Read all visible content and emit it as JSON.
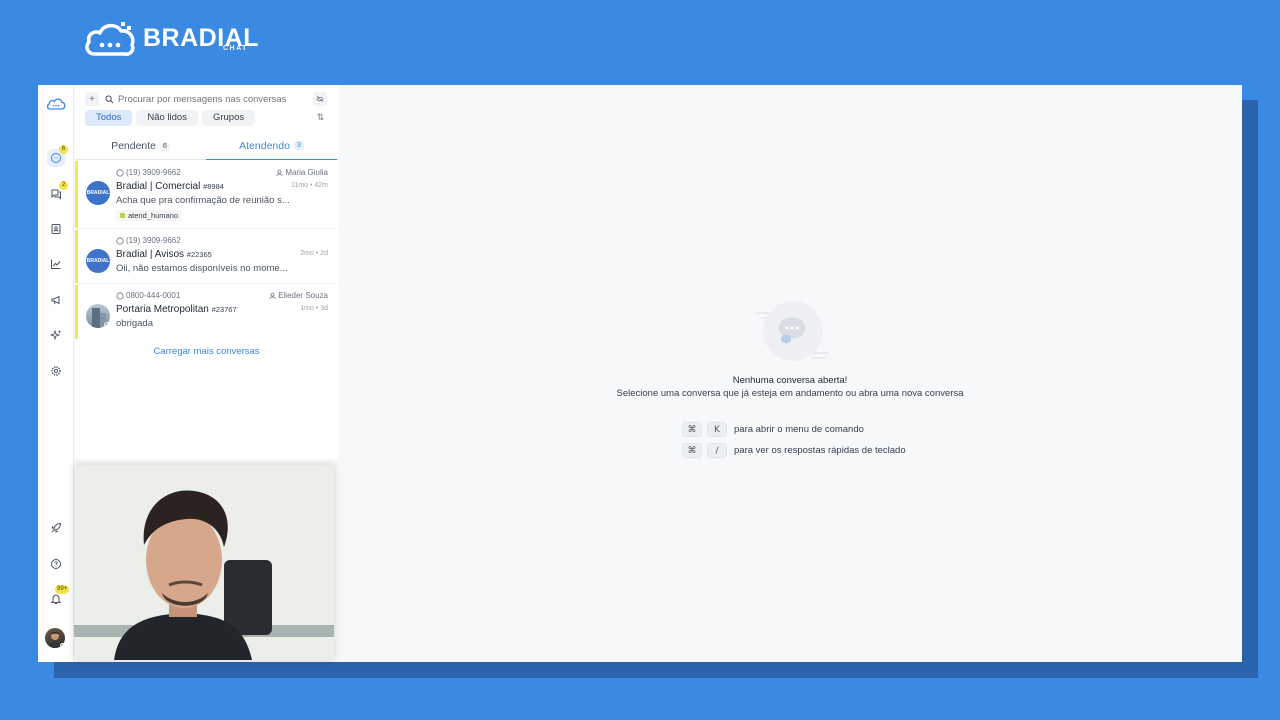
{
  "brand": {
    "name": "BRADIAL",
    "sub": "CHAT"
  },
  "rail": {
    "conversations_badge": "6",
    "mentions_badge": "2",
    "notifications_badge": "99+"
  },
  "search": {
    "placeholder": "Procurar por mensagens nas conversas"
  },
  "filters": [
    "Todos",
    "Não lidos",
    "Grupos"
  ],
  "tabs": [
    {
      "label": "Pendente",
      "count": "6"
    },
    {
      "label": "Atendendo",
      "count": "3"
    }
  ],
  "conversations": [
    {
      "phone": "(19) 3909-9662",
      "agent": "Maria Giulia",
      "title": "Bradial | Comercial",
      "number": "#8984",
      "time": "11mo • 42m",
      "preview": "Acha que pra confirmação de reunião s...",
      "tag": "atend_humano",
      "avatar_text": "BRADIAL"
    },
    {
      "phone": "(19) 3909-9662",
      "agent": "",
      "title": "Bradial | Avisos",
      "number": "#22365",
      "time": "2mo • 2d",
      "preview": "Oii, não estamos disponíveis no mome...",
      "tag": "",
      "avatar_text": "BRADIAL"
    },
    {
      "phone": "0800-444-0001",
      "agent": "Elieder Souza",
      "title": "Portaria Metropolitan",
      "number": "#23767",
      "time": "1mo • 3d",
      "preview": "obrigada",
      "tag": "",
      "avatar_text": ""
    }
  ],
  "load_more": "Carregar mais conversas",
  "empty_state": {
    "title": "Nenhuma conversa aberta!",
    "subtitle": "Selecione uma conversa que já esteja em andamento ou abra uma nova conversa",
    "shortcuts": [
      {
        "keys": [
          "⌘",
          "K"
        ],
        "label": "para abrir o menu de comando"
      },
      {
        "keys": [
          "⌘",
          "/"
        ],
        "label": "para ver os respostas rápidas de teclado"
      }
    ]
  },
  "colors": {
    "background": "#3a89e2",
    "accent": "#3a89e2",
    "badge": "#f4e247",
    "unread_bar": "#f4e84d"
  }
}
